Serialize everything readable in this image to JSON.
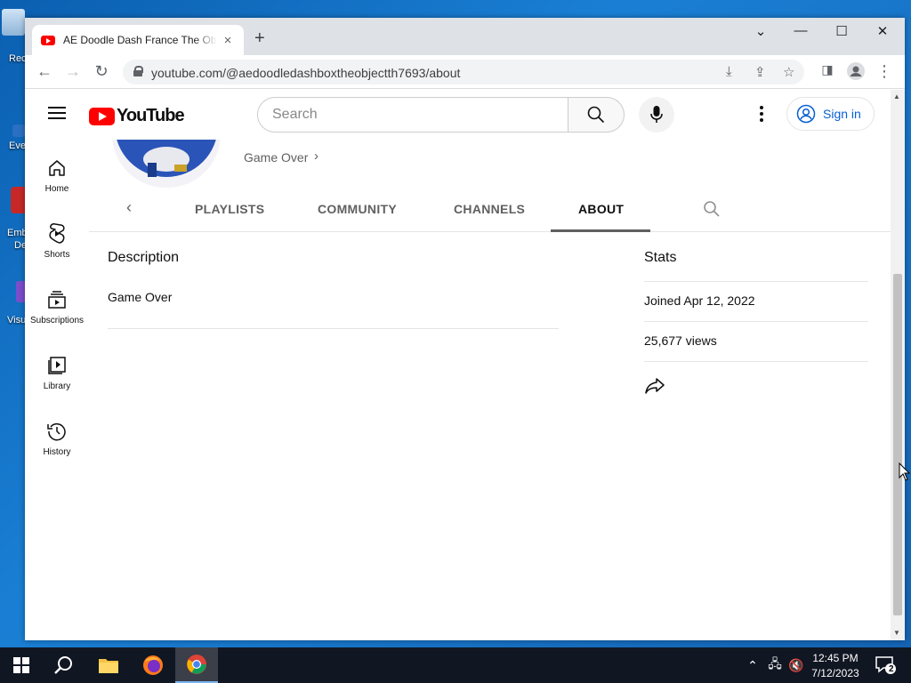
{
  "desktop": {
    "icons": [
      {
        "label": "Rec"
      },
      {
        "label": "Eve"
      },
      {
        "label": "Emb"
      },
      {
        "label": "De"
      },
      {
        "label": "Visu"
      }
    ]
  },
  "browser": {
    "tab_title": "AE Doodle Dash France The Object Show - YouTube",
    "tab_close": "×",
    "new_tab": "+",
    "url": "youtube.com/@aedoodledashboxtheobjectth7693/about"
  },
  "youtube": {
    "logo_text": "YouTube",
    "search_placeholder": "Search",
    "signin_label": "Sign in",
    "guide": [
      {
        "label": "Home",
        "icon": "home-icon"
      },
      {
        "label": "Shorts",
        "icon": "shorts-icon"
      },
      {
        "label": "Subscriptions",
        "icon": "subscriptions-icon"
      },
      {
        "label": "Library",
        "icon": "library-icon"
      },
      {
        "label": "History",
        "icon": "history-icon"
      }
    ],
    "channel": {
      "description_preview": "Game Over"
    },
    "tabs": [
      {
        "label": "PLAYLISTS"
      },
      {
        "label": "COMMUNITY"
      },
      {
        "label": "CHANNELS"
      },
      {
        "label": "ABOUT",
        "active": true
      }
    ],
    "about": {
      "description_heading": "Description",
      "description_text": "Game Over",
      "stats_heading": "Stats",
      "joined": "Joined Apr 12, 2022",
      "views": "25,677 views"
    }
  },
  "taskbar": {
    "time": "12:45 PM",
    "date": "7/12/2023",
    "notification_count": "2"
  }
}
